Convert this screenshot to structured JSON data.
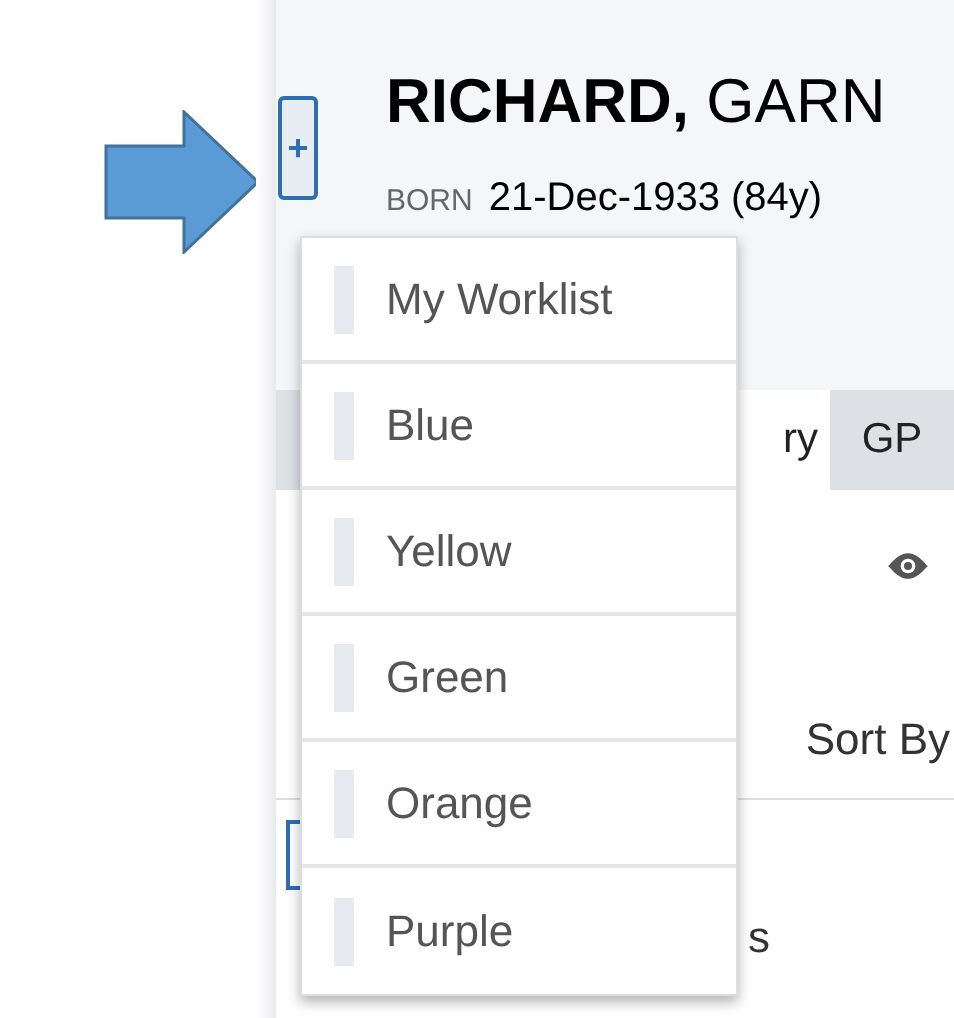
{
  "patient": {
    "add_button": "+",
    "name": "**RICHARD,** GARN",
    "born_label": "BORN",
    "born_value": "21-Dec-1933 (84y)"
  },
  "tabs": [
    {
      "label": "ry",
      "selected": true
    },
    {
      "label": "GP",
      "selected": false
    }
  ],
  "sort_label": "Sort By",
  "list_text": "s",
  "dropdown": {
    "items": [
      {
        "label": "My Worklist"
      },
      {
        "label": "Blue"
      },
      {
        "label": "Yellow"
      },
      {
        "label": "Green"
      },
      {
        "label": "Orange"
      },
      {
        "label": "Purple"
      }
    ]
  }
}
